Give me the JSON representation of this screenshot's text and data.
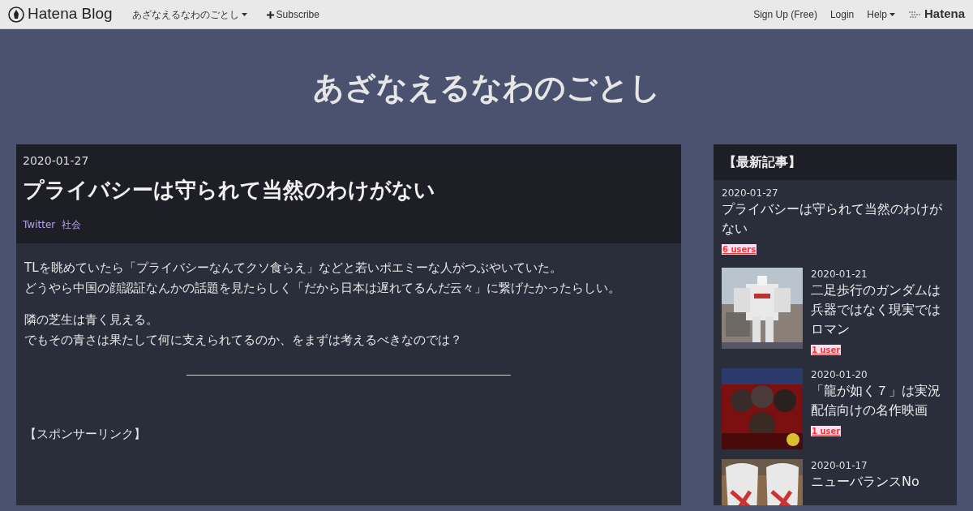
{
  "navbar": {
    "brand": "Hatena Blog",
    "blog_menu": "あざなえるなわのごとし",
    "subscribe": "Subscribe",
    "right_links": [
      {
        "label": "Sign Up (Free)",
        "dropdown": false
      },
      {
        "label": "Login",
        "dropdown": false
      },
      {
        "label": "Help",
        "dropdown": true
      }
    ],
    "logo": "Hatena"
  },
  "blog_title": "あざなえるなわのごとし",
  "article": {
    "date": "2020-01-27",
    "title": "プライバシーは守られて当然のわけがない",
    "categories": [
      "Twitter",
      "社会"
    ],
    "paragraphs": [
      [
        "TLを眺めていたら「プライバシーなんてクソ食らえ」などと若いポエミーな人がつぶやいていた。",
        "どうやら中国の顔認証なんかの話題を見たらしく「だから日本は遅れてるんだ云々」に繋げたかったらしい。"
      ],
      [
        "隣の芝生は青く見える。",
        "でもその青さは果たして何に支えられてるのか、をまずは考えるべきなのでは？"
      ]
    ],
    "sponsor": "【スポンサーリンク】"
  },
  "sidebar": {
    "title": "【最新記事】",
    "entries": [
      {
        "date": "2020-01-27",
        "title": "プライバシーは守られて当然のわけがない",
        "users": "6 users"
      },
      {
        "date": "2020-01-21",
        "title": "二足歩行のガンダムは兵器ではなく現実ではロマン",
        "users": "1 user"
      },
      {
        "date": "2020-01-20",
        "title": "「龍が如く７」は実況配信向けの名作映画",
        "users": "1 user"
      },
      {
        "date": "2020-01-17",
        "title": "ニューバランスNo"
      }
    ]
  }
}
